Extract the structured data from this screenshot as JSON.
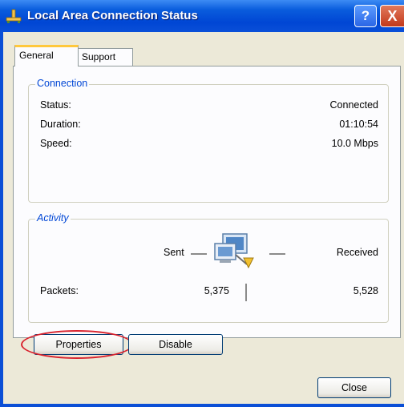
{
  "window": {
    "title": "Local Area Connection Status",
    "help_label": "?",
    "close_label": "X"
  },
  "tabs": [
    {
      "label": "General",
      "active": true
    },
    {
      "label": "Support",
      "active": false
    }
  ],
  "connection": {
    "legend": "Connection",
    "status_label": "Status:",
    "status_value": "Connected",
    "duration_label": "Duration:",
    "duration_value": "01:10:54",
    "speed_label": "Speed:",
    "speed_value": "10.0 Mbps"
  },
  "activity": {
    "legend": "Activity",
    "sent_label": "Sent",
    "received_label": "Received",
    "packets_label": "Packets:",
    "packets_sent": "5,375",
    "packets_received": "5,528"
  },
  "buttons": {
    "properties": "Properties",
    "disable": "Disable",
    "close": "Close"
  },
  "colors": {
    "title_bar": "#0a5ddd",
    "highlight_ring": "#d9232e",
    "group_legend": "#0046d5"
  },
  "icons": {
    "title": "network-connection-icon",
    "activity": "network-computers-icon"
  }
}
